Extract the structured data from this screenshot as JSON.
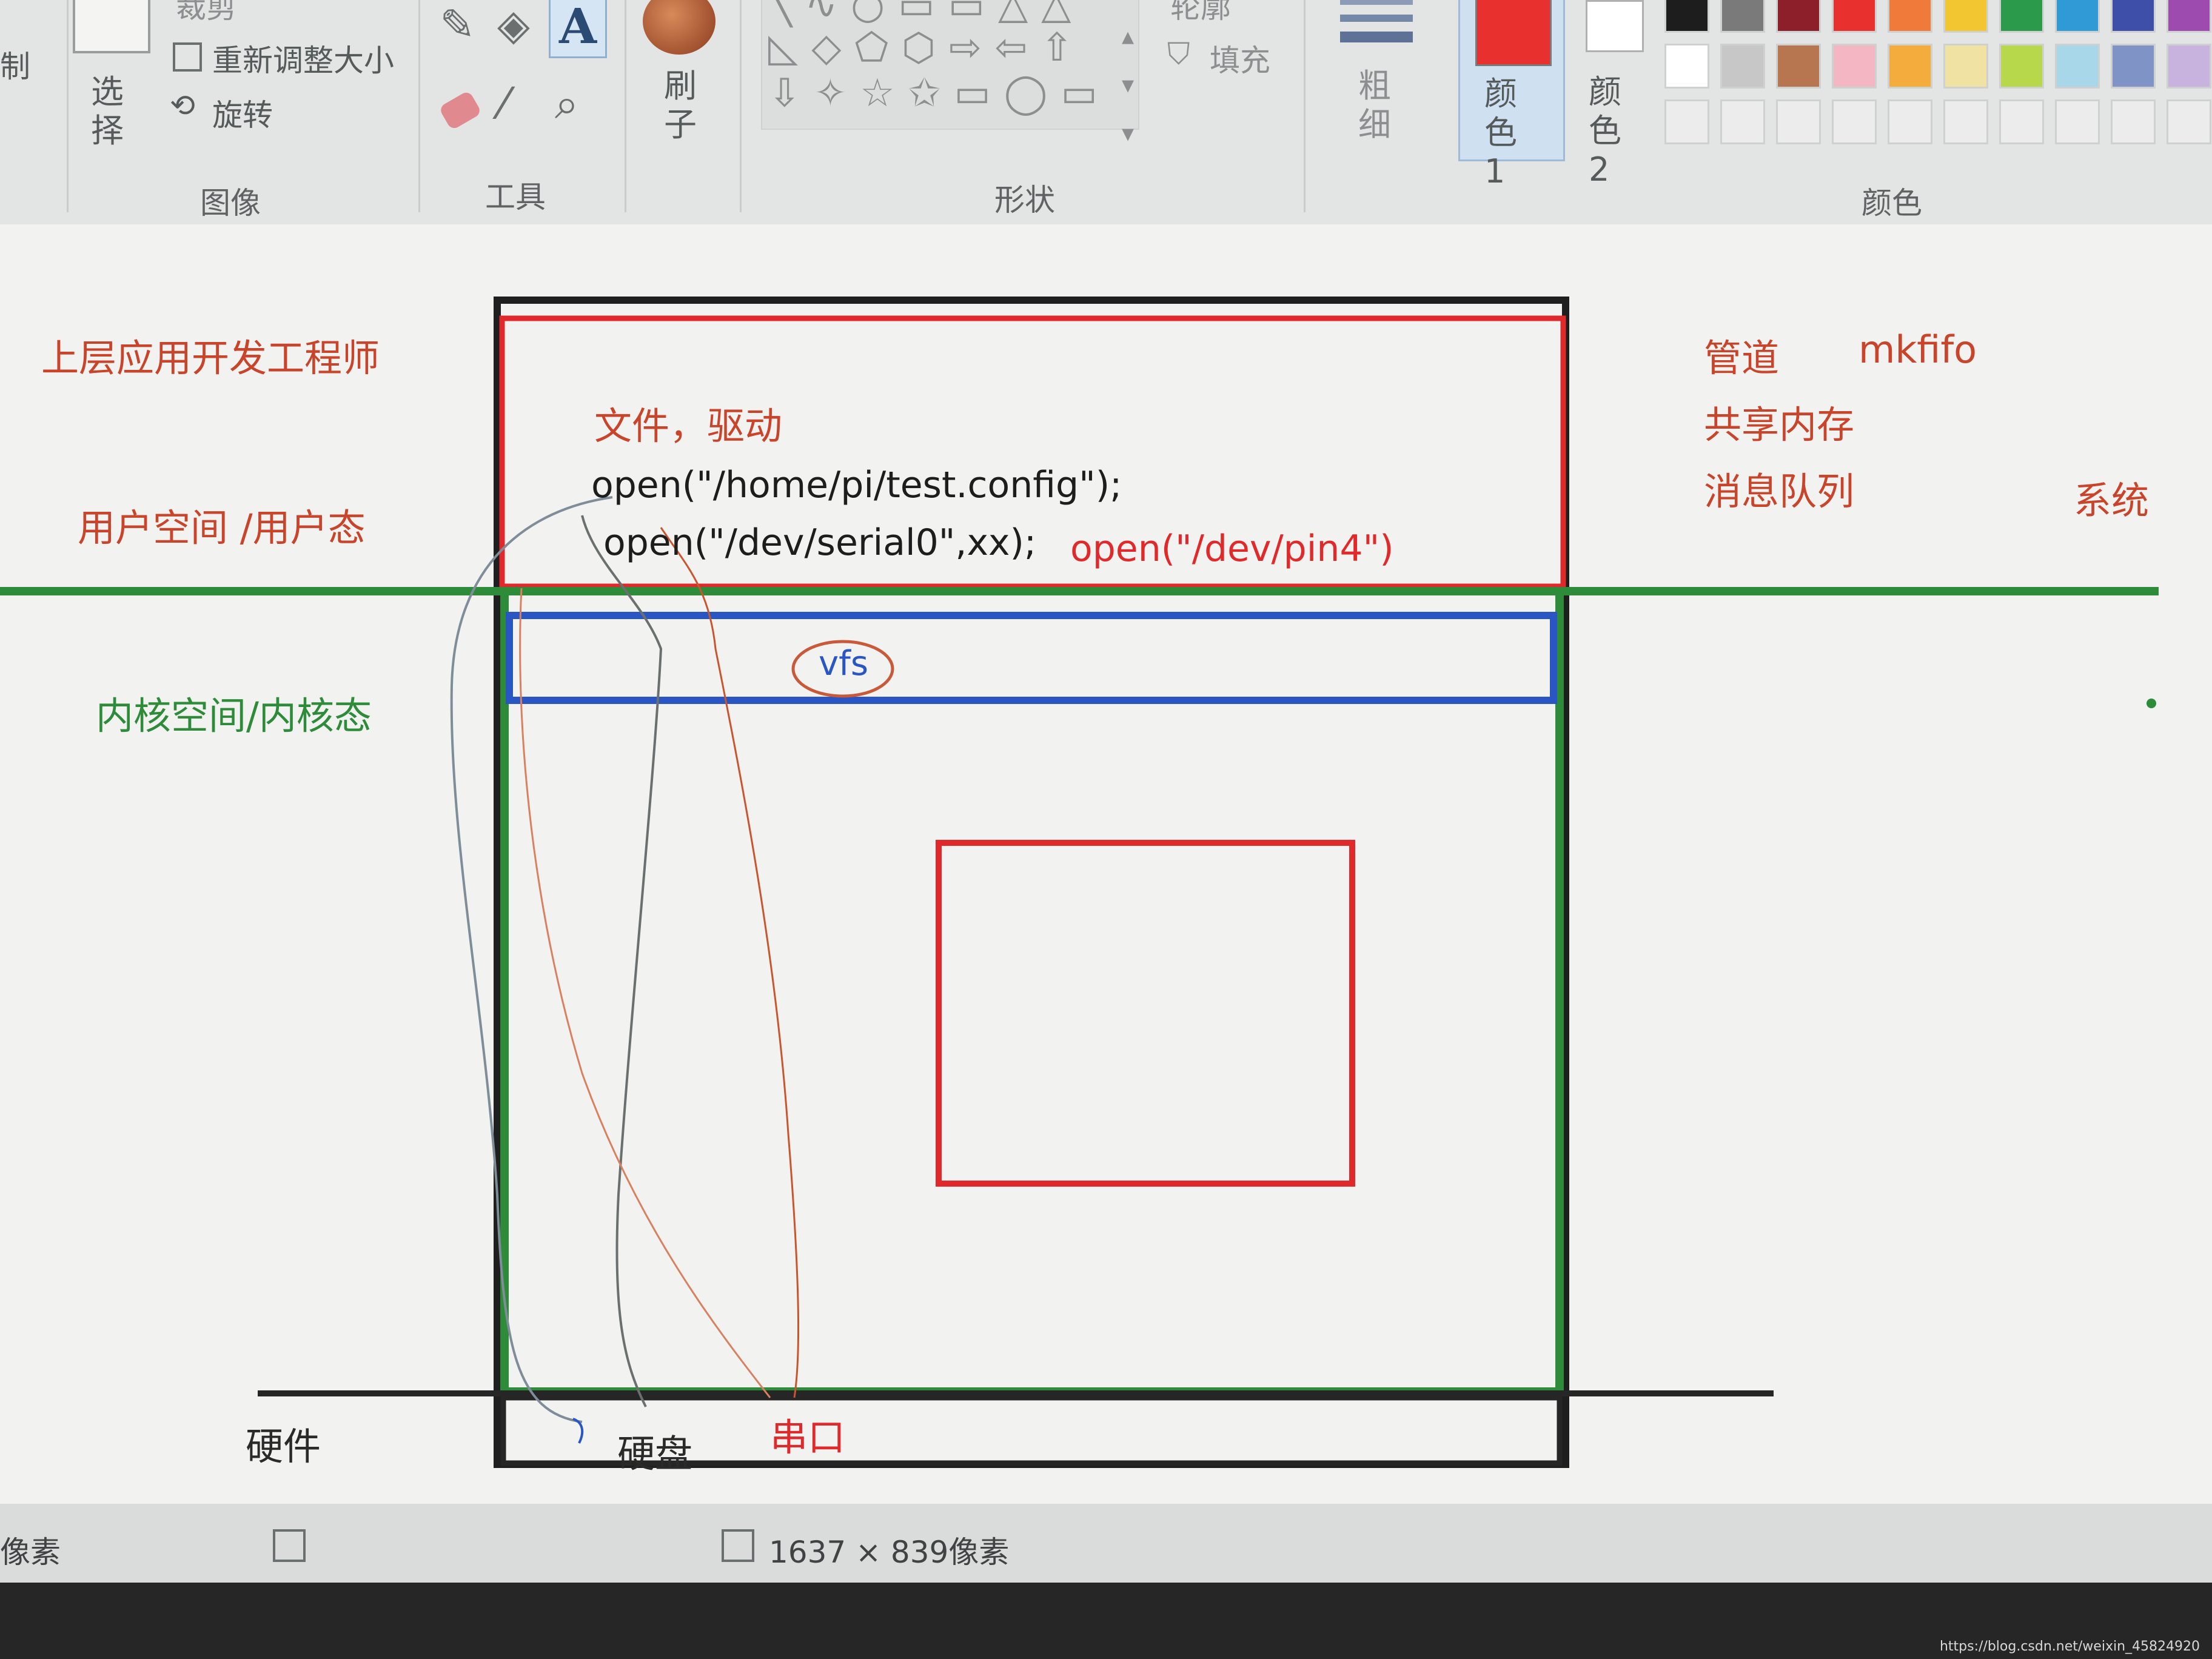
{
  "ribbon": {
    "clipboard": {
      "copy_label": "制"
    },
    "image": {
      "group_label": "图像",
      "select_label": "选择",
      "crop_label": "裁剪",
      "resize_label": "重新调整大小",
      "rotate_label": "旋转"
    },
    "tools": {
      "group_label": "工具"
    },
    "brushes": {
      "label": "刷子"
    },
    "shapes": {
      "group_label": "形状",
      "outline_label": "轮廓",
      "fill_label": "填充"
    },
    "size": {
      "label": "粗细"
    },
    "colors": {
      "group_label": "颜色",
      "color1_label": "颜色 1",
      "color2_label": "颜色 2",
      "color1_value": "#e8302e",
      "color2_value": "#ffffff",
      "palette_row1": [
        "#1d1d1d",
        "#7a7a7a",
        "#8c1f2a",
        "#e8302e",
        "#f07a3a",
        "#f2c631",
        "#2b9a4a",
        "#2f9ad6",
        "#3d4fa8",
        "#9e4bb0"
      ],
      "palette_row2": [
        "#ffffff",
        "#c7c7c7",
        "#b7764f",
        "#f5b6c4",
        "#f4ad3c",
        "#efe2a3",
        "#b7d84a",
        "#a9d7ea",
        "#7f93c7",
        "#c7b3dd"
      ]
    }
  },
  "canvas": {
    "left_labels": {
      "upper_app_engineer": "上层应用开发工程师",
      "user_space": "用户空间 /用户态",
      "kernel_space": "内核空间/内核态",
      "hardware": "硬件"
    },
    "user_box": {
      "file_driver": "文件，驱动",
      "open_config": "open(\"/home/pi/test.config\");",
      "open_serial": "open(\"/dev/serial0\",xx);",
      "open_pin": "open(\"/dev/pin4\")"
    },
    "vfs_label": "vfs",
    "hardware_items": {
      "disk": "硬盘",
      "serial_port": "串口"
    },
    "right_labels": {
      "pipe": "管道",
      "mkfifo": "mkfifo",
      "shared_memory": "共享内存",
      "message_queue": "消息队列",
      "system": "系统"
    }
  },
  "statusbar": {
    "left_text": "像素",
    "canvas_size": "1637 × 839像素"
  },
  "watermark": "https://blog.csdn.net/weixin_45824920"
}
